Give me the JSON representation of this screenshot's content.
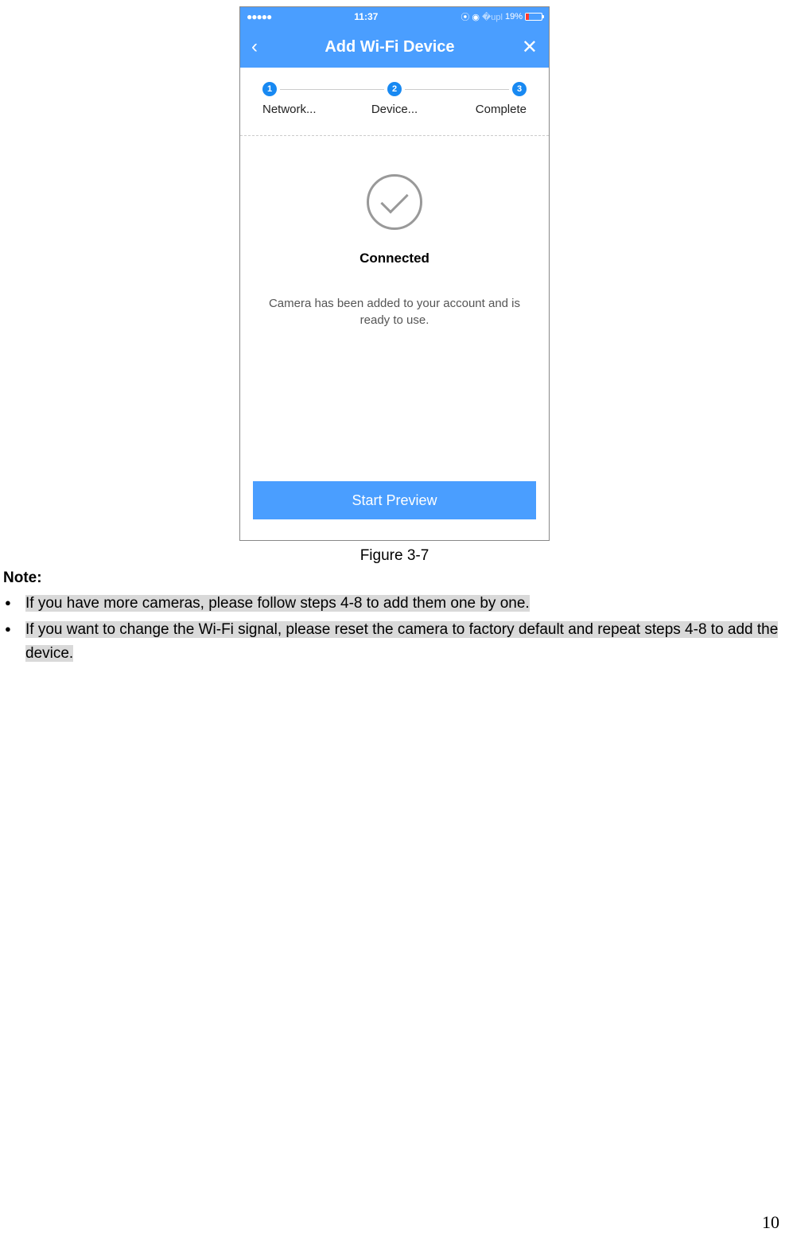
{
  "statusBar": {
    "signal": "●●●●●",
    "time": "11:37",
    "lockIcon": "lock",
    "alarmIcon": "alarm",
    "bluetoothIcon": "bluetooth",
    "battery": "19%"
  },
  "navBar": {
    "title": "Add Wi-Fi Device"
  },
  "steps": {
    "items": [
      {
        "num": "1",
        "label": "Network..."
      },
      {
        "num": "2",
        "label": "Device..."
      },
      {
        "num": "3",
        "label": "Complete"
      }
    ]
  },
  "content": {
    "statusText": "Connected",
    "message": "Camera has been added to your account and is ready to use."
  },
  "button": {
    "primary": "Start Preview"
  },
  "figure": {
    "caption": "Figure 3-7"
  },
  "notes": {
    "heading": "Note:",
    "items": [
      "If you have more cameras, please follow steps 4-8 to add them one by one.",
      "If you want to change the Wi-Fi signal, please reset the camera to factory default and repeat steps 4-8 to add the device."
    ]
  },
  "pageNumber": "10"
}
